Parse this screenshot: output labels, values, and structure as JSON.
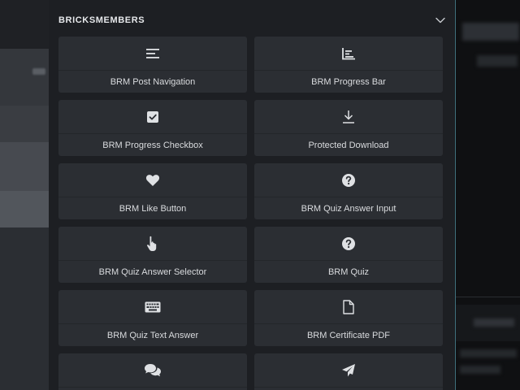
{
  "panel": {
    "title": "BRICKSMEMBERS",
    "collapse_icon": "chevron-down-icon"
  },
  "elements": [
    {
      "label": "BRM Post Navigation",
      "icon": "align-left-icon"
    },
    {
      "label": "BRM Progress Bar",
      "icon": "bar-chart-icon"
    },
    {
      "label": "BRM Progress Checkbox",
      "icon": "check-square-icon"
    },
    {
      "label": "Protected Download",
      "icon": "download-icon"
    },
    {
      "label": "BRM Like Button",
      "icon": "heart-icon"
    },
    {
      "label": "BRM Quiz Answer Input",
      "icon": "question-circle-icon"
    },
    {
      "label": "BRM Quiz Answer Selector",
      "icon": "hand-pointer-icon"
    },
    {
      "label": "BRM Quiz",
      "icon": "question-circle-icon"
    },
    {
      "label": "BRM Quiz Text Answer",
      "icon": "keyboard-icon"
    },
    {
      "label": "BRM Certificate PDF",
      "icon": "file-icon"
    },
    {
      "label": "",
      "icon": "comments-icon"
    },
    {
      "label": "",
      "icon": "paper-plane-icon"
    }
  ]
}
